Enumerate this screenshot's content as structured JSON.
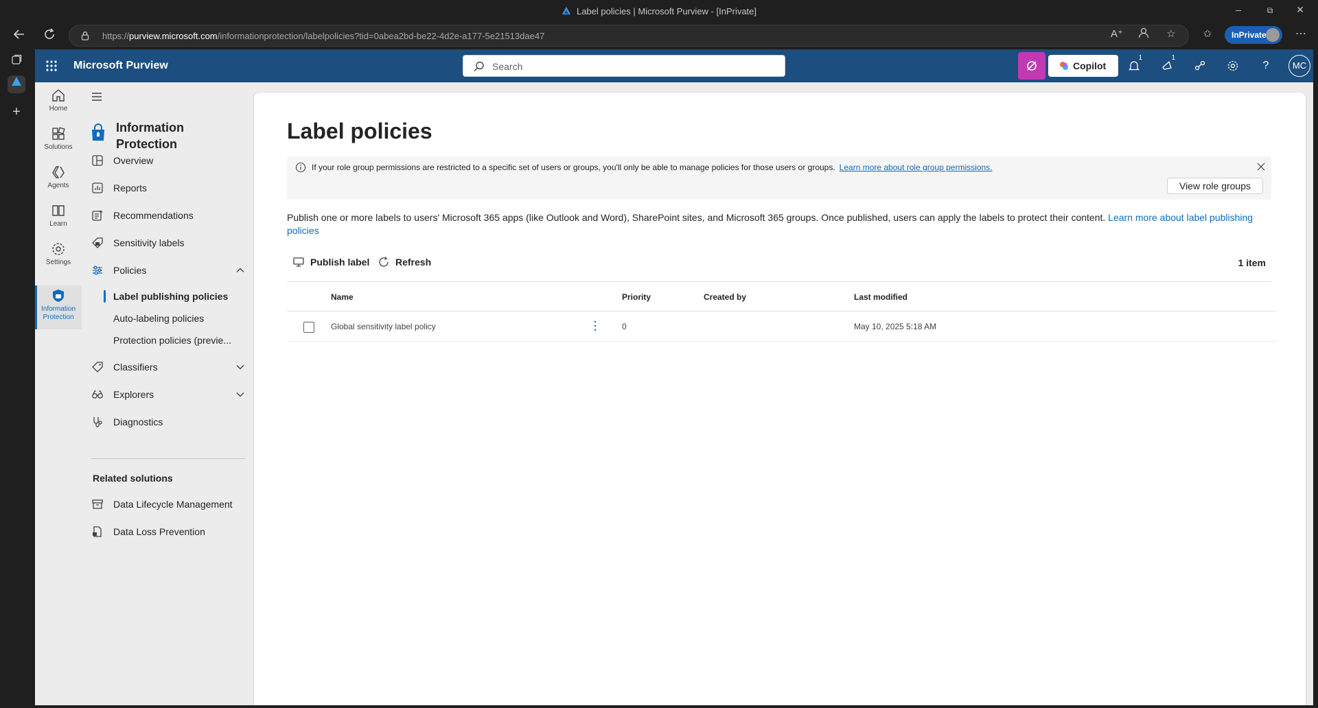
{
  "browser": {
    "window_title": "Label policies | Microsoft Purview - [InPrivate]",
    "url_prefix": "https://",
    "url_host": "purview.microsoft.com",
    "url_path": "/informationprotection/labelpolicies?tid=0abea2bd-be22-4d2e-a177-5e21513dae47",
    "inprivate_label": "InPrivate"
  },
  "topbar": {
    "app_name": "Microsoft Purview",
    "search_placeholder": "Search",
    "copilot_label": "Copilot",
    "notifications_badge": "1",
    "whatsnew_badge": "1",
    "avatar_initials": "MC"
  },
  "app_rail": {
    "items": [
      {
        "label": "Home",
        "icon": "home-icon"
      },
      {
        "label": "Solutions",
        "icon": "solutions-icon"
      },
      {
        "label": "Agents",
        "icon": "agents-icon"
      },
      {
        "label": "Learn",
        "icon": "learn-icon"
      },
      {
        "label": "Settings",
        "icon": "settings-icon"
      },
      {
        "label": "Information Protection",
        "icon": "information-protection-icon"
      }
    ]
  },
  "leftnav": {
    "solution_name": "Information Protection",
    "items": [
      {
        "label": "Overview"
      },
      {
        "label": "Reports"
      },
      {
        "label": "Recommendations"
      },
      {
        "label": "Sensitivity labels"
      },
      {
        "label": "Policies"
      }
    ],
    "policies_sub": [
      {
        "label": "Label publishing policies"
      },
      {
        "label": "Auto-labeling policies"
      },
      {
        "label": "Protection policies (previe..."
      }
    ],
    "more_items": [
      {
        "label": "Classifiers"
      },
      {
        "label": "Explorers"
      },
      {
        "label": "Diagnostics"
      }
    ],
    "related_header": "Related solutions",
    "related": [
      {
        "label": "Data Lifecycle Management"
      },
      {
        "label": "Data Loss Prevention"
      }
    ]
  },
  "main": {
    "title": "Label policies",
    "info_message": "If your role group permissions are restricted to a specific set of users or groups, you'll only be able to manage policies for those users or groups.",
    "info_link": "Learn more about role group permissions.",
    "view_role_groups": "View role groups",
    "description": "Publish one or more labels to users' Microsoft 365 apps (like Outlook and Word), SharePoint sites, and Microsoft 365 groups. Once published, users can apply the labels to protect their content.",
    "description_link": "Learn more about label publishing policies",
    "commands": {
      "publish": "Publish label",
      "refresh": "Refresh"
    },
    "item_count": "1 item",
    "columns": {
      "name": "Name",
      "priority": "Priority",
      "created_by": "Created by",
      "last_modified": "Last modified"
    },
    "rows": [
      {
        "name": "Global sensitivity label policy",
        "priority": "0",
        "created_by": "",
        "last_modified": "May 10, 2025 5:18 AM"
      }
    ]
  },
  "colors": {
    "topbar": "#1c4e80",
    "accent": "#0f6cbd",
    "copilot_pink": "#c239b3"
  }
}
